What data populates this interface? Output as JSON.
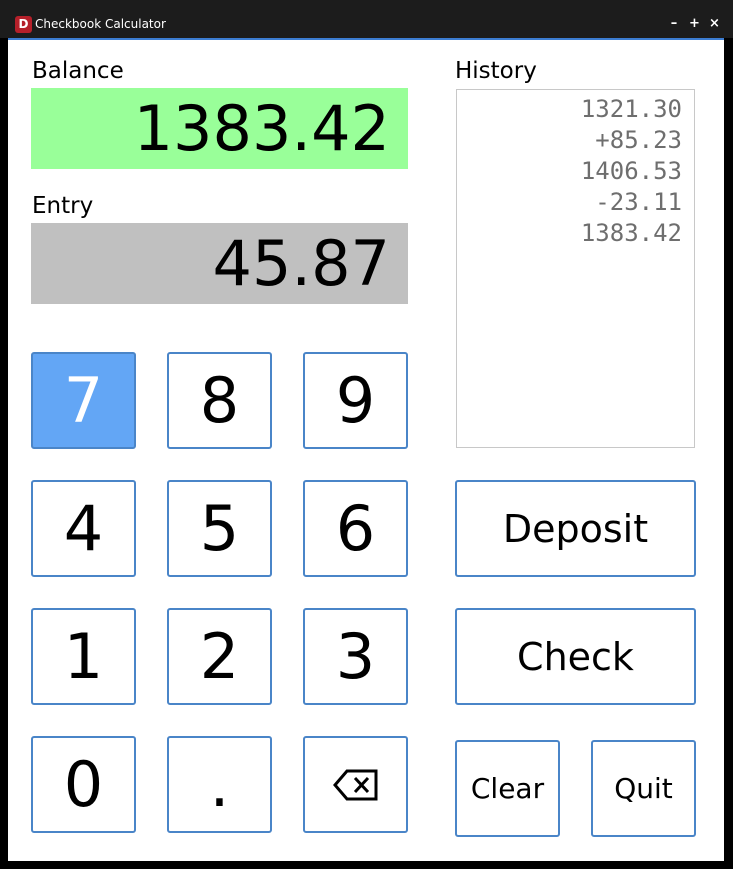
{
  "window": {
    "title": "Checkbook Calculator",
    "icon_letter": "D",
    "controls": [
      "–",
      "+",
      "×"
    ]
  },
  "balance": {
    "label": "Balance",
    "value": "1383.42",
    "bg_color": "#99ff99"
  },
  "entry": {
    "label": "Entry",
    "value": "45.87",
    "bg_color": "#c0c0c0"
  },
  "history": {
    "label": "History",
    "lines": [
      "1321.30",
      "+85.23",
      "1406.53",
      "-23.11",
      "1383.42"
    ]
  },
  "keypad": {
    "k7": "7",
    "k8": "8",
    "k9": "9",
    "k4": "4",
    "k5": "5",
    "k6": "6",
    "k1": "1",
    "k2": "2",
    "k3": "3",
    "k0": "0",
    "dot": ".",
    "backspace": "⌫",
    "active_key": "7",
    "active_color": "#63a6f5"
  },
  "actions": {
    "deposit": "Deposit",
    "check": "Check",
    "clear": "Clear",
    "quit": "Quit"
  },
  "accent_color": "#4a85c8"
}
